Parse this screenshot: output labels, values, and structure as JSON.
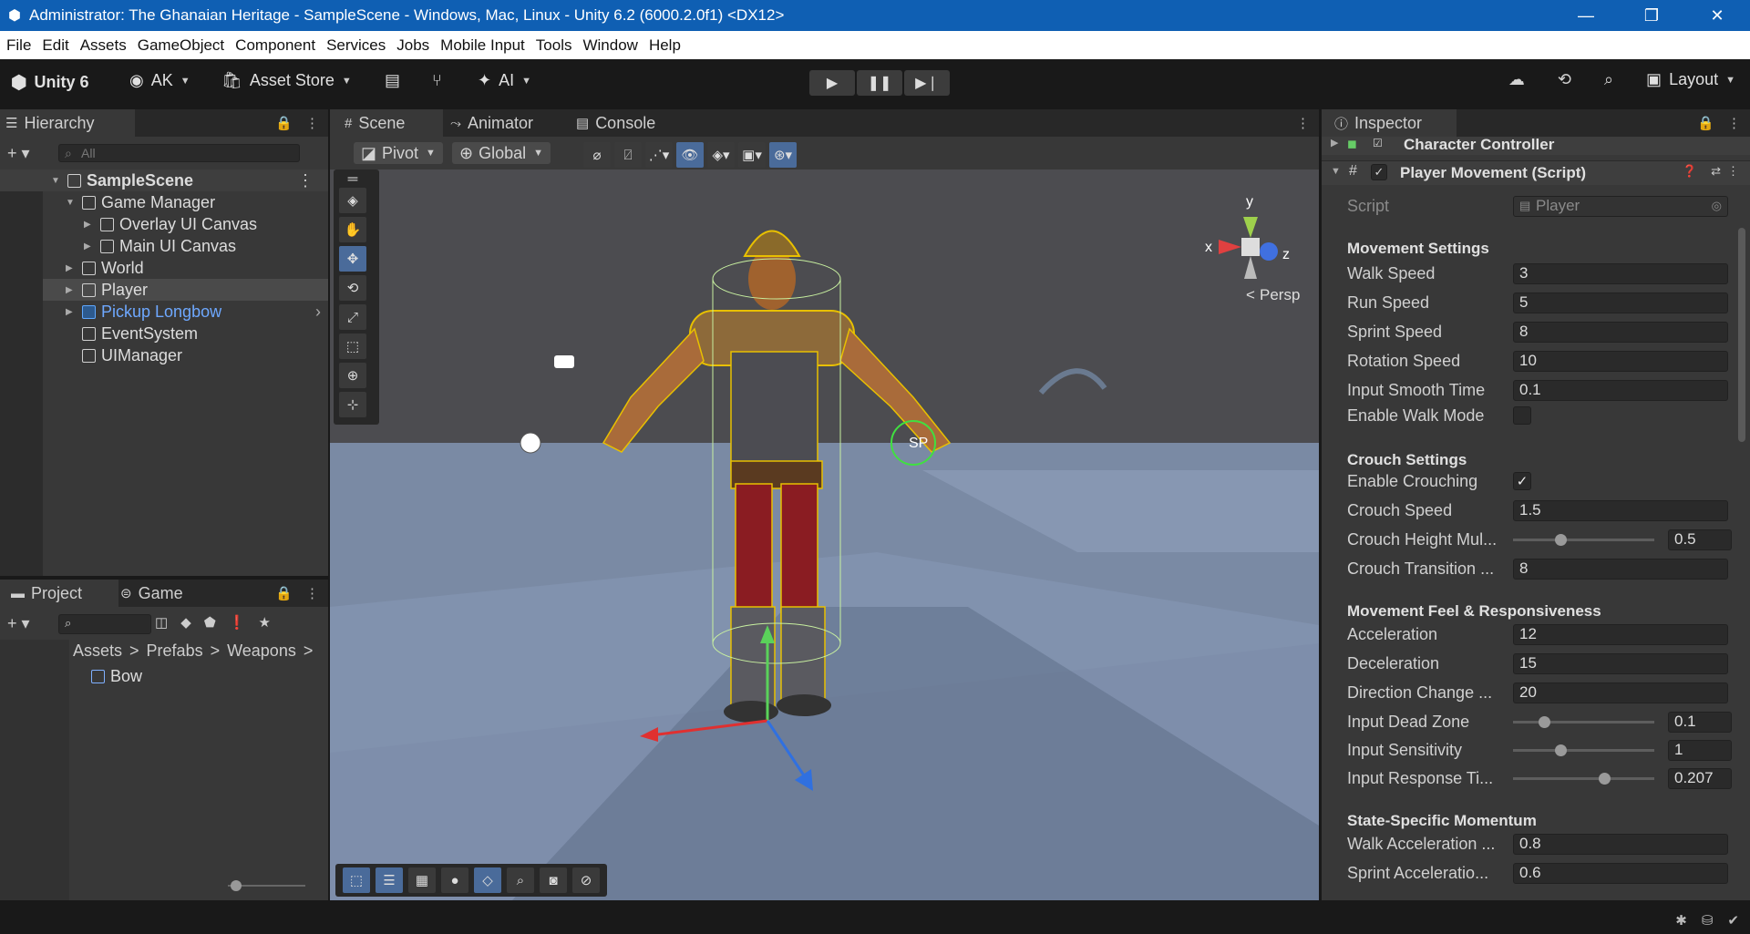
{
  "window": {
    "title": "Administrator: The Ghanaian Heritage - SampleScene - Windows, Mac, Linux - Unity 6.2 (6000.2.0f1) <DX12>",
    "minimize": "—",
    "maximize": "❐",
    "close": "✕"
  },
  "menu": [
    "File",
    "Edit",
    "Assets",
    "GameObject",
    "Component",
    "Services",
    "Jobs",
    "Mobile Input",
    "Tools",
    "Window",
    "Help"
  ],
  "toolbar": {
    "unity_label": "Unity 6",
    "account_label": "AK",
    "asset_store_label": "Asset Store",
    "ai_label": "AI",
    "layout_label": "Layout"
  },
  "hierarchy": {
    "tab_label": "Hierarchy",
    "search_placeholder": "All",
    "scene_name": "SampleScene",
    "items": [
      {
        "label": "Game Manager"
      },
      {
        "label": "Overlay UI Canvas"
      },
      {
        "label": "Main UI Canvas"
      },
      {
        "label": "World"
      },
      {
        "label": "Player"
      },
      {
        "label": "Pickup Longbow"
      },
      {
        "label": "EventSystem"
      },
      {
        "label": "UIManager"
      }
    ]
  },
  "project": {
    "tab_project": "Project",
    "tab_game": "Game",
    "breadcrumb": [
      "Assets",
      "Prefabs",
      "Weapons"
    ],
    "asset": "Bow"
  },
  "scene": {
    "tab_scene": "Scene",
    "tab_animator": "Animator",
    "tab_console": "Console",
    "pivot_label": "Pivot",
    "global_label": "Global",
    "persp_label": "Persp",
    "gizmo_y": "y",
    "gizmo_x": "x",
    "gizmo_z": "z",
    "sp_label": "SP"
  },
  "inspector": {
    "tab_label": "Inspector",
    "component_character_controller": "Character Controller",
    "component_player_movement": "Player Movement (Script)",
    "script_label": "Script",
    "script_value": "Player",
    "sections": {
      "movement": "Movement Settings",
      "crouch": "Crouch Settings",
      "feel": "Movement Feel & Responsiveness",
      "momentum": "State-Specific Momentum"
    },
    "fields": {
      "walk_speed": {
        "label": "Walk Speed",
        "value": "3"
      },
      "run_speed": {
        "label": "Run Speed",
        "value": "5"
      },
      "sprint_speed": {
        "label": "Sprint Speed",
        "value": "8"
      },
      "rotation_speed": {
        "label": "Rotation Speed",
        "value": "10"
      },
      "input_smooth_time": {
        "label": "Input Smooth Time",
        "value": "0.1"
      },
      "enable_walk_mode": {
        "label": "Enable Walk Mode"
      },
      "enable_crouching": {
        "label": "Enable Crouching",
        "check": "✓"
      },
      "crouch_speed": {
        "label": "Crouch Speed",
        "value": "1.5"
      },
      "crouch_height": {
        "label": "Crouch Height Mul...",
        "value": "0.5"
      },
      "crouch_transition": {
        "label": "Crouch Transition ...",
        "value": "8"
      },
      "acceleration": {
        "label": "Acceleration",
        "value": "12"
      },
      "deceleration": {
        "label": "Deceleration",
        "value": "15"
      },
      "direction_change": {
        "label": "Direction Change ...",
        "value": "20"
      },
      "input_dead_zone": {
        "label": "Input Dead Zone",
        "value": "0.1"
      },
      "input_sensitivity": {
        "label": "Input Sensitivity",
        "value": "1"
      },
      "input_response": {
        "label": "Input Response Ti...",
        "value": "0.207"
      },
      "walk_accel": {
        "label": "Walk Acceleration ...",
        "value": "0.8"
      },
      "sprint_accel": {
        "label": "Sprint Acceleratio...",
        "value": "0.6"
      }
    }
  }
}
